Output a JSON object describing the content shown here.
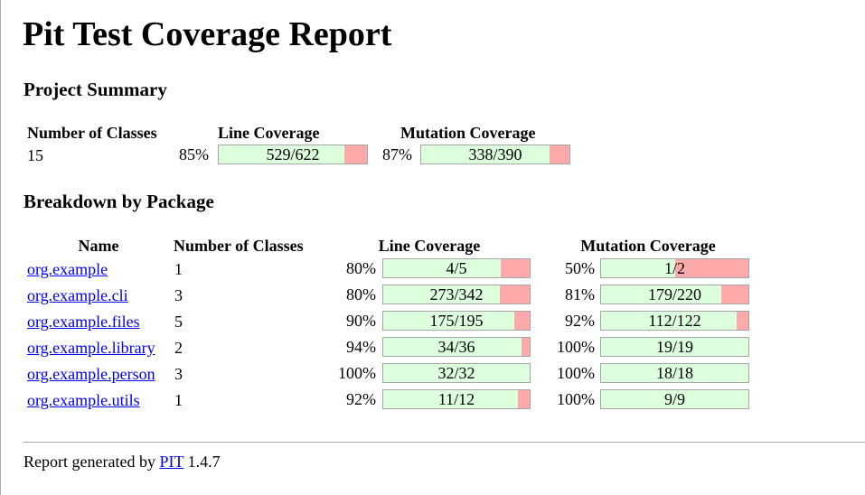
{
  "title": "Pit Test Coverage Report",
  "project_summary": {
    "heading": "Project Summary",
    "headers": {
      "classes": "Number of Classes",
      "line": "Line Coverage",
      "mutation": "Mutation Coverage"
    },
    "classes": "15",
    "line": {
      "pct": "85%",
      "ratio": "529/622",
      "fraction": 0.85
    },
    "mutation": {
      "pct": "87%",
      "ratio": "338/390",
      "fraction": 0.867
    }
  },
  "breakdown": {
    "heading": "Breakdown by Package",
    "headers": {
      "name": "Name",
      "classes": "Number of Classes",
      "line": "Line Coverage",
      "mutation": "Mutation Coverage"
    },
    "rows": [
      {
        "name": "org.example",
        "classes": "1",
        "line_pct": "80%",
        "line_ratio": "4/5",
        "line_frac": 0.8,
        "mut_pct": "50%",
        "mut_ratio": "1/2",
        "mut_frac": 0.5
      },
      {
        "name": "org.example.cli",
        "classes": "3",
        "line_pct": "80%",
        "line_ratio": "273/342",
        "line_frac": 0.798,
        "mut_pct": "81%",
        "mut_ratio": "179/220",
        "mut_frac": 0.814
      },
      {
        "name": "org.example.files",
        "classes": "5",
        "line_pct": "90%",
        "line_ratio": "175/195",
        "line_frac": 0.897,
        "mut_pct": "92%",
        "mut_ratio": "112/122",
        "mut_frac": 0.918
      },
      {
        "name": "org.example.library",
        "classes": "2",
        "line_pct": "94%",
        "line_ratio": "34/36",
        "line_frac": 0.944,
        "mut_pct": "100%",
        "mut_ratio": "19/19",
        "mut_frac": 1.0
      },
      {
        "name": "org.example.person",
        "classes": "3",
        "line_pct": "100%",
        "line_ratio": "32/32",
        "line_frac": 1.0,
        "mut_pct": "100%",
        "mut_ratio": "18/18",
        "mut_frac": 1.0
      },
      {
        "name": "org.example.utils",
        "classes": "1",
        "line_pct": "92%",
        "line_ratio": "11/12",
        "line_frac": 0.917,
        "mut_pct": "100%",
        "mut_ratio": "9/9",
        "mut_frac": 1.0
      }
    ]
  },
  "footer": {
    "prefix": "Report generated by",
    "link": "PIT",
    "version": "1.4.7"
  },
  "colors": {
    "covered": "#ddffdd",
    "uncovered": "#ffaaaa",
    "link": "#0000ee"
  }
}
